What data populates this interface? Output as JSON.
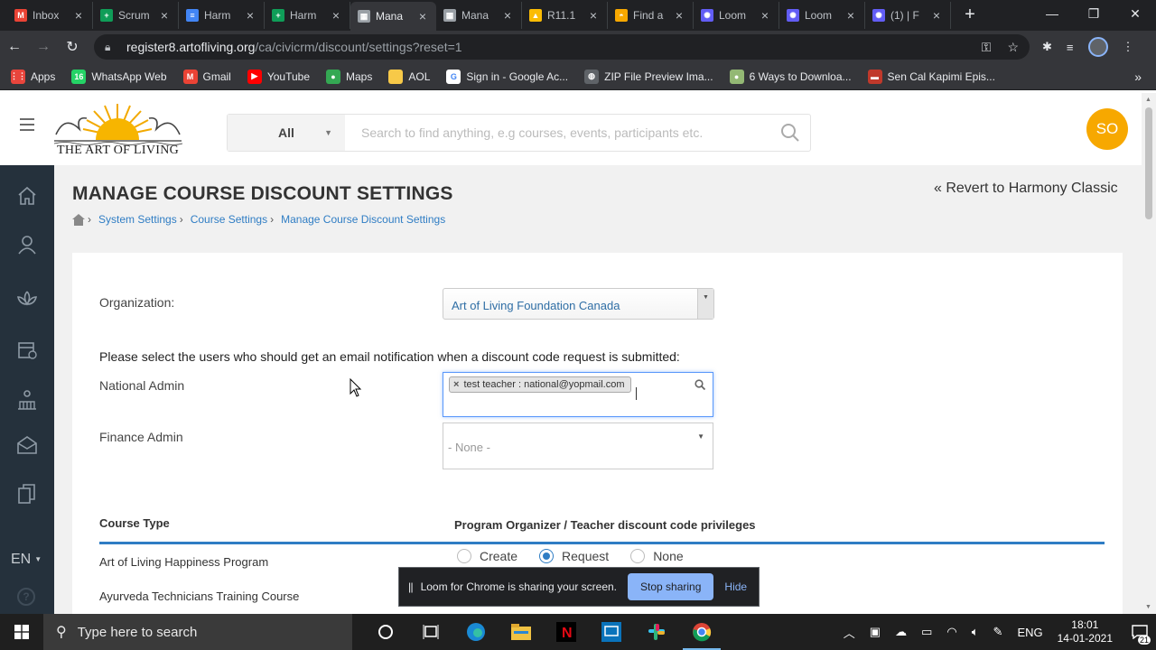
{
  "browser": {
    "tabs": [
      {
        "title": "Inbox",
        "icon": "gmail-icon",
        "color": "#ea4335",
        "glyph": "M",
        "active": false
      },
      {
        "title": "Scrum",
        "icon": "sheets-icon",
        "color": "#0f9d58",
        "glyph": "+",
        "active": false
      },
      {
        "title": "Harm",
        "icon": "docs-icon",
        "color": "#4285f4",
        "glyph": "≡",
        "active": false
      },
      {
        "title": "Harm",
        "icon": "sheets-icon",
        "color": "#0f9d58",
        "glyph": "+",
        "active": false
      },
      {
        "title": "Mana",
        "icon": "page-icon",
        "color": "#9aa0a6",
        "glyph": "▦",
        "active": true
      },
      {
        "title": "Mana",
        "icon": "page-icon",
        "color": "#9aa0a6",
        "glyph": "▦",
        "active": false
      },
      {
        "title": "R11.1",
        "icon": "drive-icon",
        "color": "#fbbc04",
        "glyph": "▲",
        "active": false
      },
      {
        "title": "Find a",
        "icon": "aol-icon",
        "color": "#f7a800",
        "glyph": "◓",
        "active": false
      },
      {
        "title": "Loom",
        "icon": "loom-icon",
        "color": "#625df5",
        "glyph": "✺",
        "active": false
      },
      {
        "title": "Loom",
        "icon": "loom-icon",
        "color": "#625df5",
        "glyph": "✺",
        "active": false
      },
      {
        "title": "(1) | F",
        "icon": "loom-icon",
        "color": "#625df5",
        "glyph": "✺",
        "active": false
      }
    ],
    "url_host": "register8.artofliving.org",
    "url_path": "/ca/civicrm/discount/settings?reset=1",
    "bookmarks": [
      {
        "label": "Apps",
        "icon": "apps-grid-icon",
        "color": "#e8453c",
        "glyph": "⋮⋮"
      },
      {
        "label": "WhatsApp Web",
        "icon": "whatsapp-icon",
        "color": "#25d366",
        "glyph": "16"
      },
      {
        "label": "Gmail",
        "icon": "gmail-icon",
        "color": "#ea4335",
        "glyph": "M"
      },
      {
        "label": "YouTube",
        "icon": "youtube-icon",
        "color": "#ff0000",
        "glyph": "▶"
      },
      {
        "label": "Maps",
        "icon": "maps-icon",
        "color": "#34a853",
        "glyph": "●"
      },
      {
        "label": "AOL",
        "icon": "folder-icon",
        "color": "#f7c948",
        "glyph": ""
      },
      {
        "label": "Sign in - Google Ac...",
        "icon": "google-icon",
        "color": "#ffffff",
        "glyph": "G"
      },
      {
        "label": "ZIP File Preview Ima...",
        "icon": "globe-icon",
        "color": "#5f6368",
        "glyph": "◍"
      },
      {
        "label": "6 Ways to Downloa...",
        "icon": "wikihow-icon",
        "color": "#93b874",
        "glyph": "●"
      },
      {
        "label": "Sen Cal Kapimi Epis...",
        "icon": "tv-icon",
        "color": "#c0392b",
        "glyph": "▬"
      }
    ],
    "bookmarks_more": "»"
  },
  "header": {
    "logo_text": "THE ART OF LIVING",
    "search_category": "All",
    "search_placeholder": "Search to find anything, e.g courses, events, participants etc.",
    "user_initials": "SO"
  },
  "sidebar": {
    "items": [
      "home-icon",
      "people-icon",
      "lotus-icon",
      "calendar-icon",
      "organization-icon",
      "mail-icon",
      "documents-icon"
    ],
    "language": "EN",
    "help": "?"
  },
  "page": {
    "title": "MANAGE COURSE DISCOUNT SETTINGS",
    "revert_link": "Revert to Harmony Classic",
    "breadcrumb": [
      "System Settings",
      "Course Settings",
      "Manage Course Discount Settings"
    ],
    "organization_label": "Organization:",
    "organization_value": "Art of Living Foundation Canada",
    "notice": "Please select the users who should get an email notification when a discount code request is submitted:",
    "national_admin_label": "National Admin",
    "national_admin_chip": "test teacher : national@yopmail.com",
    "finance_admin_label": "Finance Admin",
    "finance_admin_value": "- None -",
    "table_head_course": "Course Type",
    "table_head_priv": "Program Organizer / Teacher discount code privileges",
    "rows": [
      "Art of Living Happiness Program",
      "Ayurveda Technicians Training Course"
    ],
    "radio_options": [
      "Create",
      "Request",
      "None"
    ],
    "radio_selected": "Request"
  },
  "loom": {
    "message": "Loom for Chrome is sharing your screen.",
    "stop_label": "Stop sharing",
    "hide_label": "Hide"
  },
  "taskbar": {
    "search_placeholder": "Type here to search",
    "lang": "ENG",
    "time": "18:01",
    "date": "14-01-2021",
    "notifications": "21"
  },
  "colors": {
    "accent": "#2f7dc4",
    "avatar": "#f7a800",
    "sidebar": "#25313c"
  }
}
